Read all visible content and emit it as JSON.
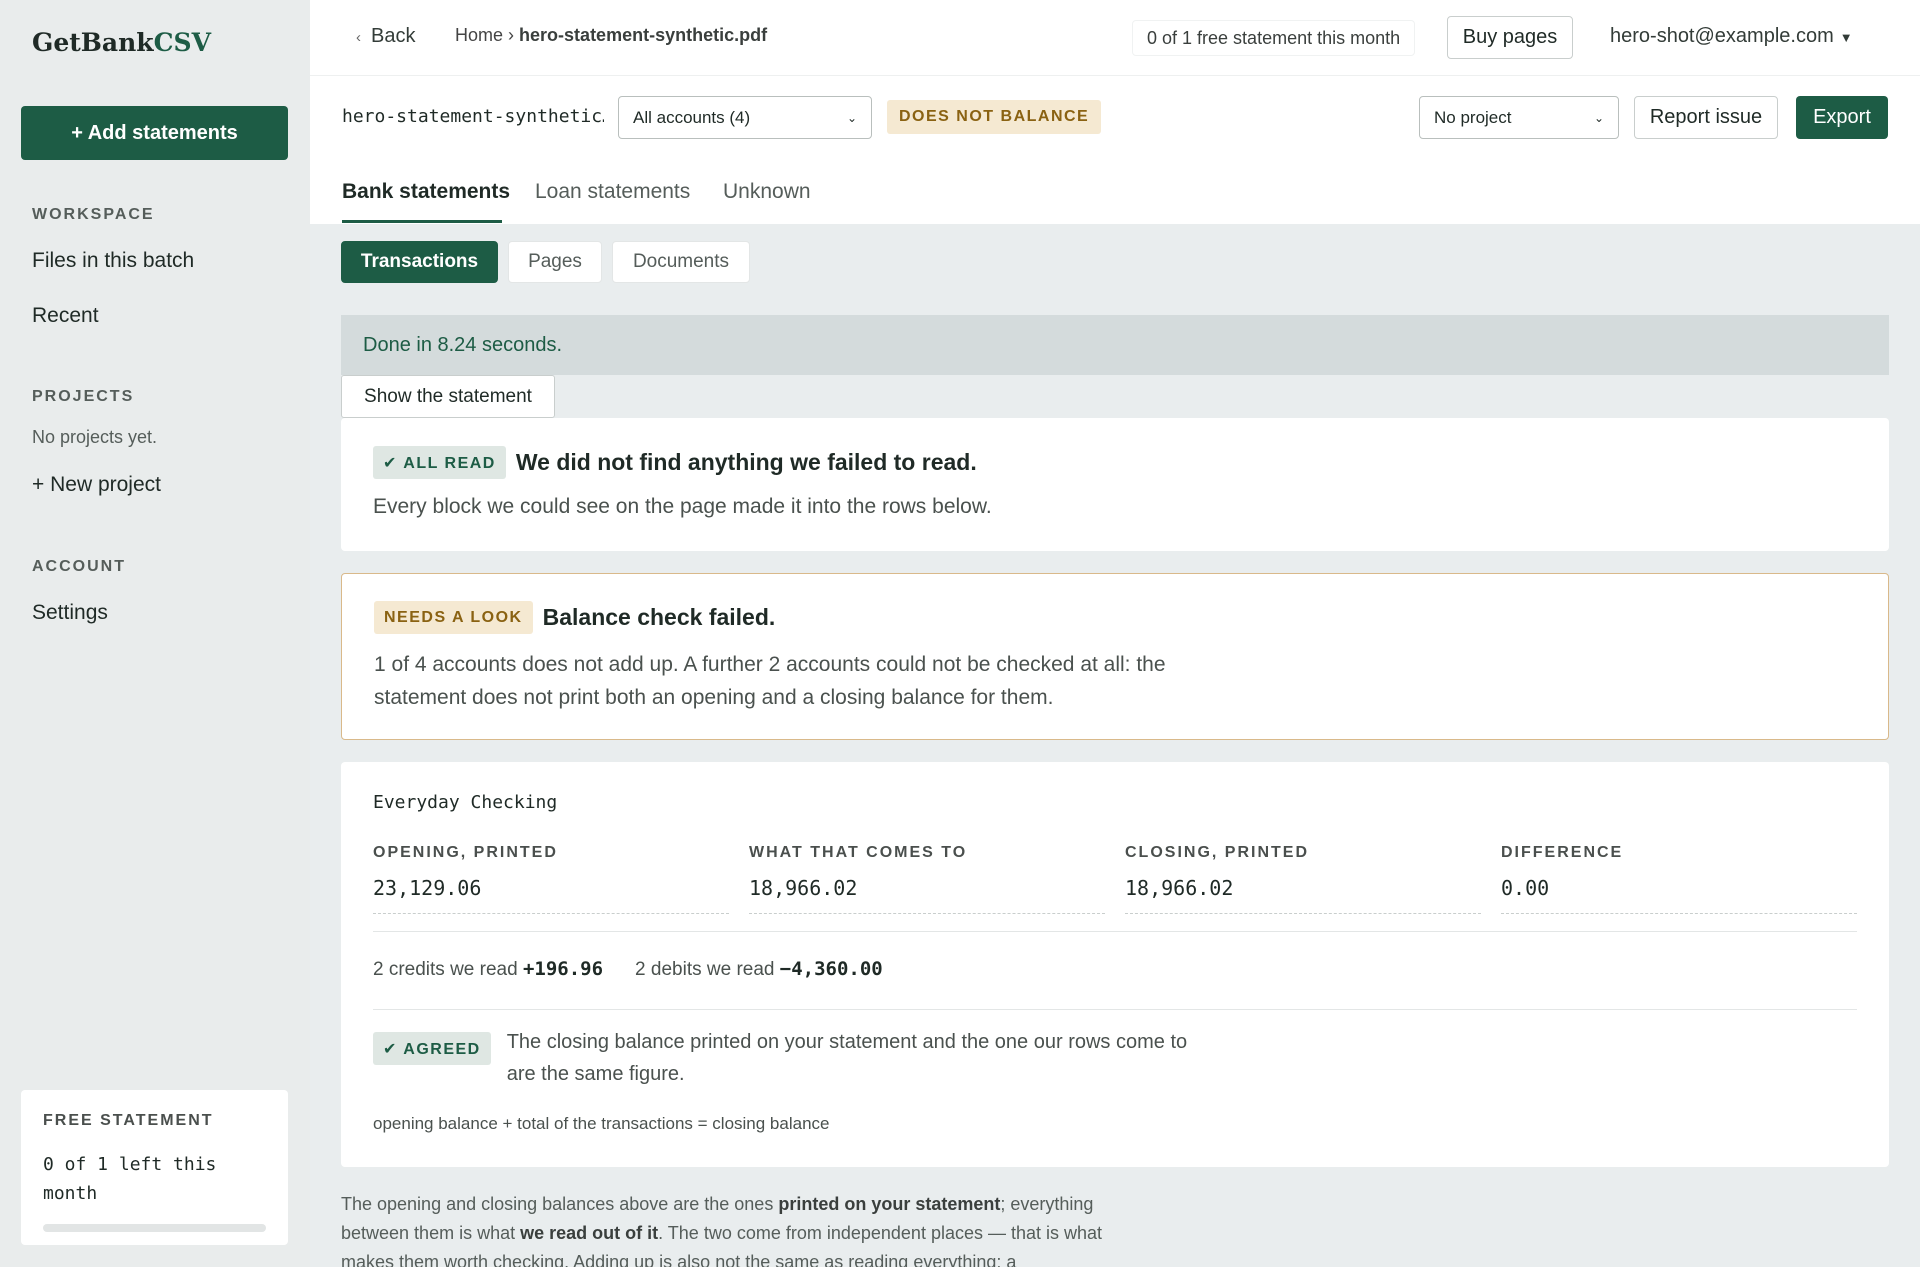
{
  "sidebar": {
    "brand_main": "GetBank",
    "brand_accent": "CSV",
    "add_label": "+ Add statements",
    "workspace_heading": "WORKSPACE",
    "workspace_items": [
      "Files in this batch",
      "Recent"
    ],
    "projects_heading": "PROJECTS",
    "projects_empty": "No projects yet.",
    "new_project": "+ New project",
    "account_heading": "ACCOUNT",
    "settings": "Settings",
    "free": {
      "heading": "FREE STATEMENT",
      "text": "0 of 1 left this month",
      "used_fraction": 0
    }
  },
  "topbar": {
    "back": "Back",
    "crumb_home": "Home",
    "crumb_sep": "›",
    "crumb_file": "hero-statement-synthetic.pdf",
    "quota": "0 of 1 free statement this month",
    "buy": "Buy pages",
    "user": "hero-shot@example.com"
  },
  "toolbar": {
    "filename": "hero-statement-synthetic…",
    "accounts_select": "All accounts (4)",
    "status_badge": "DOES NOT BALANCE",
    "project_select": "No project",
    "report": "Report issue",
    "export": "Export"
  },
  "tabs": [
    "Bank statements",
    "Loan statements",
    "Unknown"
  ],
  "subtabs": [
    "Transactions",
    "Pages",
    "Documents"
  ],
  "done_msg": "Done in 8.24 seconds.",
  "show_statement": "Show the statement",
  "read_card": {
    "pill": "✔ ALL READ",
    "title": "We did not find anything we failed to read.",
    "body": "Every block we could see on the page made it into the rows below."
  },
  "balance_card": {
    "pill": "NEEDS A LOOK",
    "title": "Balance check failed.",
    "body_line1": "1 of 4 accounts does not add up. A further 2 accounts could not be checked at all: the",
    "body_line2": "statement does not print both an opening and a closing balance for them."
  },
  "account_card": {
    "name": "Everyday Checking",
    "cols": [
      {
        "head": "OPENING, PRINTED",
        "value": "23,129.06"
      },
      {
        "head": "WHAT THAT COMES TO",
        "value": "18,966.02"
      },
      {
        "head": "CLOSING, PRINTED",
        "value": "18,966.02"
      },
      {
        "head": "DIFFERENCE",
        "value": "0.00"
      }
    ],
    "credits_label": "2 credits we read",
    "credits_value": "+196.96",
    "debits_label": "2 debits we read",
    "debits_value": "−4,360.00",
    "agreed_pill": "✔ AGREED",
    "agreed_line1": "The closing balance printed on your statement and the one our rows come to",
    "agreed_line2": "are the same figure.",
    "formula": "opening balance + total of the transactions = closing balance"
  },
  "footnote": {
    "p1": "The opening and closing balances above are the ones ",
    "b1": "printed on your statement",
    "p2": "; everything between them is what ",
    "b2": "we read out of it",
    "p3": ". The two come from independent places — that is what makes them worth checking. Adding up is also not the same as reading everything; a"
  },
  "colors": {
    "accent": "#1d5c45",
    "warn_bg": "#f5e9d2",
    "warn_text": "#8a6212"
  }
}
